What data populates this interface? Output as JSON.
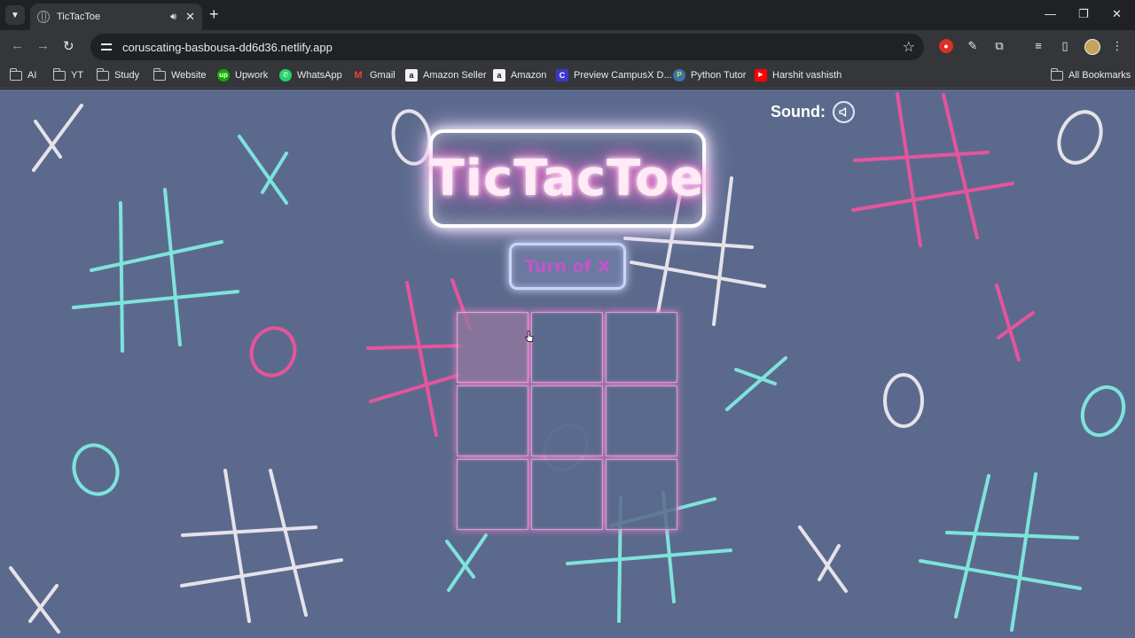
{
  "browser": {
    "tab_title": "TicTacToe",
    "url": "coruscating-basbousa-dd6d36.netlify.app",
    "new_tab_label": "+",
    "bookmarks": [
      {
        "label": "AI",
        "icon": "folder-icon"
      },
      {
        "label": "YT",
        "icon": "folder-icon"
      },
      {
        "label": "Study",
        "icon": "folder-icon"
      },
      {
        "label": "Website",
        "icon": "folder-icon"
      },
      {
        "label": "Upwork",
        "icon": "upwork-icon"
      },
      {
        "label": "WhatsApp",
        "icon": "whatsapp-icon"
      },
      {
        "label": "Gmail",
        "icon": "gmail-icon"
      },
      {
        "label": "Amazon Seller",
        "icon": "amazon-icon"
      },
      {
        "label": "Amazon",
        "icon": "amazon-icon"
      },
      {
        "label": "Preview CampusX D...",
        "icon": "campusx-icon"
      },
      {
        "label": "Python Tutor",
        "icon": "python-icon"
      },
      {
        "label": "Harshit vashisth",
        "icon": "youtube-icon"
      }
    ],
    "all_bookmarks_label": "All Bookmarks"
  },
  "game": {
    "title": "TicTacToe",
    "turn_text": "Turn of X",
    "sound_label": "Sound:",
    "board": [
      "",
      "",
      "",
      "",
      "",
      "",
      "",
      "",
      ""
    ]
  },
  "colors": {
    "page_bg": "#5b6a8c",
    "accent_pink": "#e6549b",
    "accent_cyan": "#7fe3dc",
    "accent_white": "#e6e2ea",
    "turn_text": "#c156c8"
  }
}
